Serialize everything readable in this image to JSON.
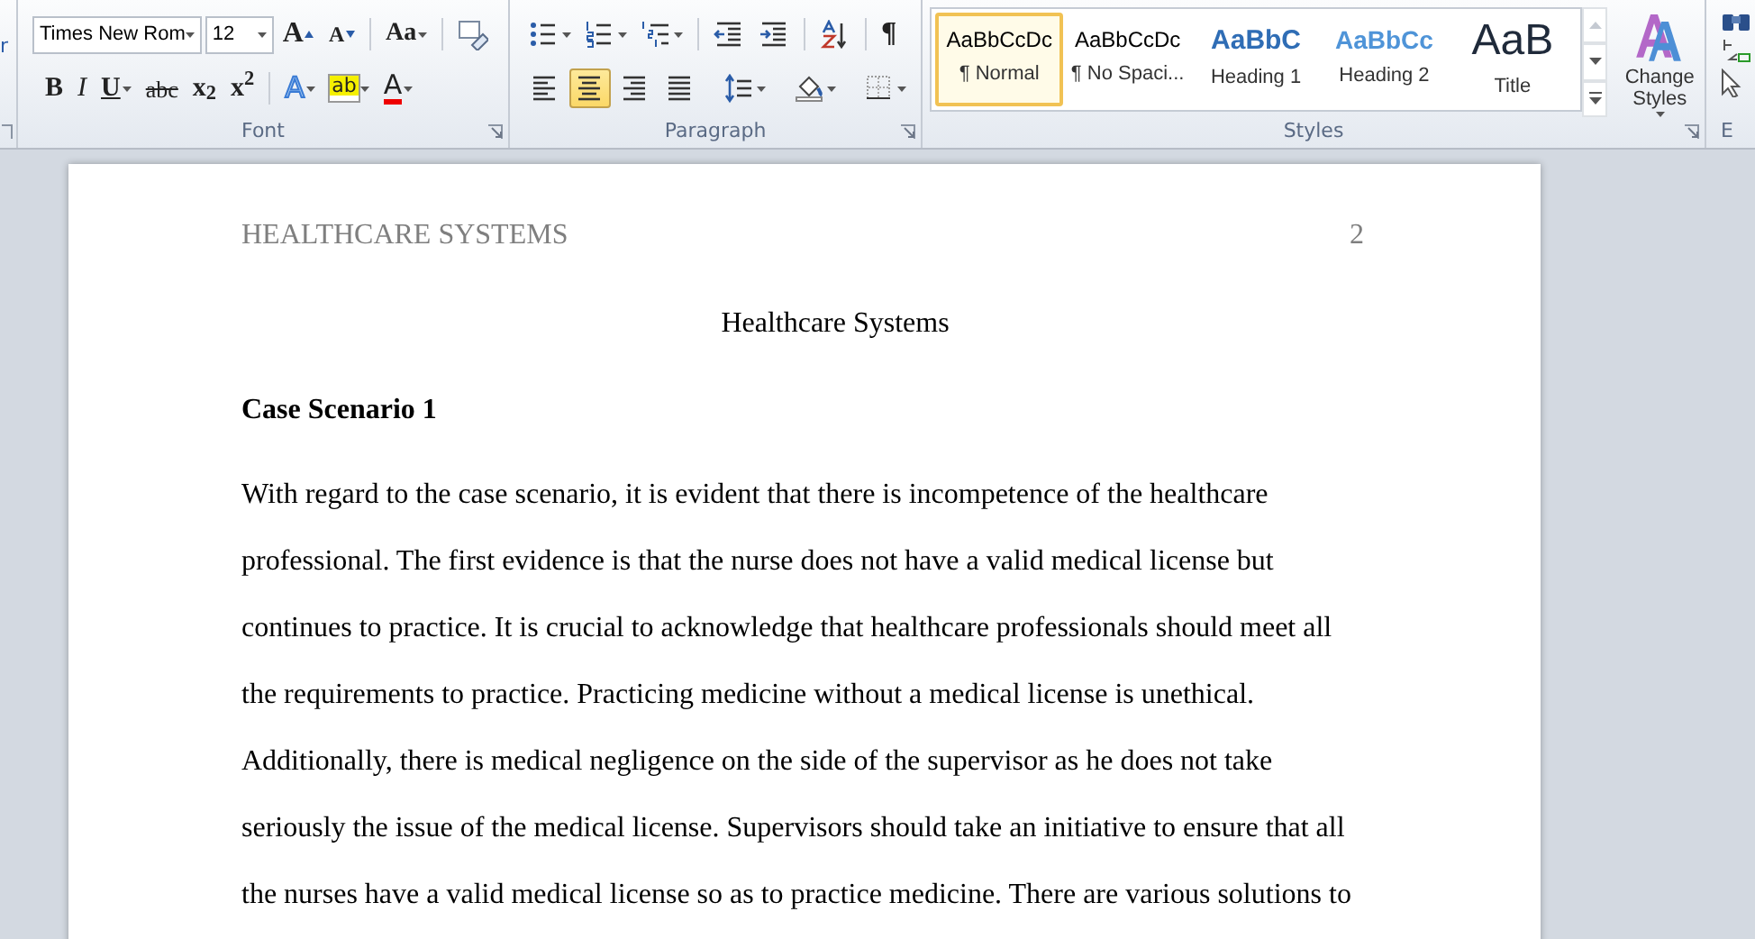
{
  "ribbon": {
    "clipboard_fragment": {
      "label": "r"
    },
    "font_group": {
      "label": "Font",
      "font_name": "Times New Rom",
      "font_size": "12",
      "row_1": [
        {
          "kind": "grow",
          "glyph": "A"
        },
        {
          "kind": "shrink",
          "glyph": "A"
        },
        {
          "kind": "case",
          "glyph": "Aa"
        },
        {
          "kind": "clear"
        }
      ],
      "row_2": [
        {
          "kind": "bold",
          "glyph": "B"
        },
        {
          "kind": "italic",
          "glyph": "I"
        },
        {
          "kind": "underline",
          "glyph": "U"
        },
        {
          "kind": "strike",
          "glyph": "abc"
        },
        {
          "kind": "sub",
          "glyph": "x$_{2}$"
        },
        {
          "kind": "sup",
          "glyph": "x$^{2}$"
        },
        {
          "kind": "effects",
          "glyph": "A"
        },
        {
          "kind": "highlight",
          "glyph": "ab"
        },
        {
          "kind": "color",
          "glyph": "A"
        }
      ]
    },
    "paragraph_group": {
      "label": "Paragraph",
      "row_1": [
        {
          "kind": "bullets"
        },
        {
          "kind": "numbering"
        },
        {
          "kind": "multilevel"
        },
        {
          "kind": "outdent"
        },
        {
          "kind": "indent"
        },
        {
          "kind": "sort"
        },
        {
          "kind": "marks",
          "glyph": "¶"
        }
      ],
      "alignment": [
        {
          "kind": "left",
          "selected": false
        },
        {
          "kind": "center",
          "selected": true
        },
        {
          "kind": "right",
          "selected": false
        },
        {
          "kind": "justify",
          "selected": false
        }
      ],
      "row_2": [
        {
          "kind": "spacing"
        },
        {
          "kind": "shading"
        },
        {
          "kind": "borders"
        }
      ]
    },
    "styles_group": {
      "label": "Styles",
      "change_styles": "Change Styles",
      "items": [
        {
          "sample": "AaBbCcDc",
          "name": "¶ Normal",
          "kind": "normal",
          "selected": true
        },
        {
          "sample": "AaBbCcDc",
          "name": "¶ No Spaci...",
          "kind": "normal",
          "selected": false
        },
        {
          "sample": "AaBbC",
          "name": "Heading 1",
          "kind": "heading1",
          "selected": false
        },
        {
          "sample": "AaBbCc",
          "name": "Heading 2",
          "kind": "heading2",
          "selected": false
        },
        {
          "sample": "AaB",
          "name": "Title",
          "kind": "title",
          "selected": false
        }
      ]
    },
    "editing_fragment": {
      "label": "E"
    }
  },
  "document": {
    "header": {
      "title": "HEALTHCARE SYSTEMS",
      "page_number": "2"
    },
    "title": "Healthcare Systems",
    "heading": "Case Scenario 1",
    "paragraph": "With regard to the case scenario, it is evident that there is incompetence of the healthcare professional. The first evidence is that the nurse does not have a valid medical license but continues to practice. It is crucial to acknowledge that healthcare professionals should meet all the requirements to practice. Practicing medicine without a medical license is unethical. Additionally, there is medical negligence on the side of the supervisor as he does not take seriously the issue of the medical license. Supervisors should take an initiative to ensure that all the nurses have a valid medical license so as to practice medicine. There are various solutions to"
  }
}
